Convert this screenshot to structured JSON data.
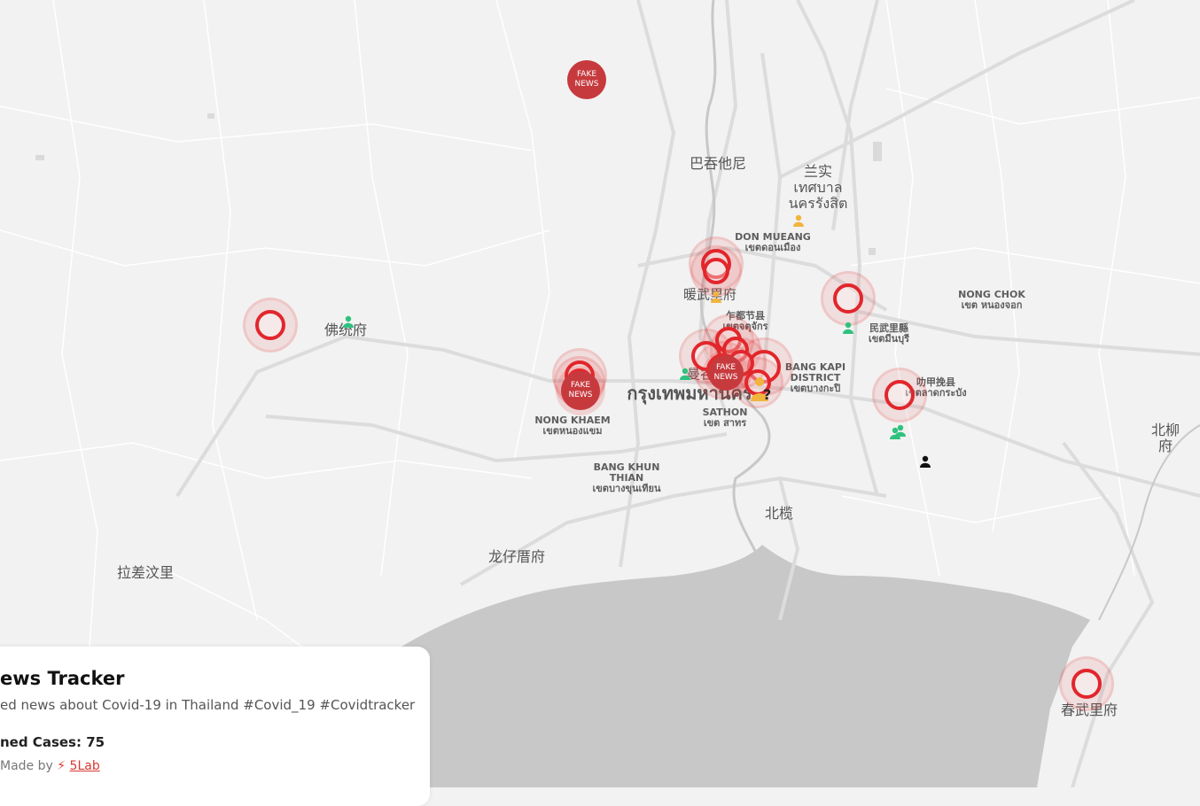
{
  "map": {
    "labels": [
      {
        "text": "巴吞他尼",
        "cls": "cjk"
      },
      {
        "text": "兰实\nเทศบาล\nนครรังสิต",
        "cls": "cjk"
      },
      {
        "text": "DON MUEANG\nเขตดอนเมือง",
        "cls": "district"
      },
      {
        "text": "暖武里府",
        "cls": "mid"
      },
      {
        "text": "NONG CHOK\nเขต หนองจอก",
        "cls": "district"
      },
      {
        "text": "乍都节县\nเขตจตุจักร",
        "cls": "district"
      },
      {
        "text": "民武里縣\nเขตมีนบุรี",
        "cls": "district"
      },
      {
        "text": "佛统府",
        "cls": "cjk"
      },
      {
        "text": "曼谷",
        "cls": "mid"
      },
      {
        "text": "BANG KAPI\nDISTRICT\nเขตบางกะปิ",
        "cls": "district"
      },
      {
        "text": "叻甲挽县\nเขตลาดกระบัง",
        "cls": "district"
      },
      {
        "text": "กรุงเทพมหานคร",
        "cls": "big"
      },
      {
        "text": "SATHON\nเขต สาทร",
        "cls": "district"
      },
      {
        "text": "NONG KHAEM\nเขตหนองแขม",
        "cls": "district"
      },
      {
        "text": "北柳府",
        "cls": "cjk"
      },
      {
        "text": "BANG KHUN\nTHIAN\nเขตบางขุนเทียน",
        "cls": "district"
      },
      {
        "text": "北榄",
        "cls": "cjk"
      },
      {
        "text": "龙仔厝府",
        "cls": "cjk"
      },
      {
        "text": "拉差汶里",
        "cls": "cjk"
      },
      {
        "text": "春武里府",
        "cls": "cjk"
      }
    ],
    "fake_news_label": "FAKE\nNEWS",
    "unknown_marker_symbol": "?",
    "colors": {
      "land": "#f2f2f2",
      "sea": "#c8c8c8",
      "road": "#ffffff",
      "major_road": "#dcdcdc",
      "case_ring": "#e2262c",
      "fake_news": "#c63a3e",
      "recovered_person": "#2ec27e",
      "unknown_person": "#f1b43c",
      "other_person": "#111111"
    }
  },
  "panel": {
    "title": "ews Tracker",
    "subtitle": "ed news about Covid-19 in Thailand #Covid_19 #Covidtracker",
    "cases_label": "ned Cases: 75",
    "made_by_prefix": "Made by",
    "made_by_icon": "⚡",
    "made_by_link": "5Lab"
  }
}
